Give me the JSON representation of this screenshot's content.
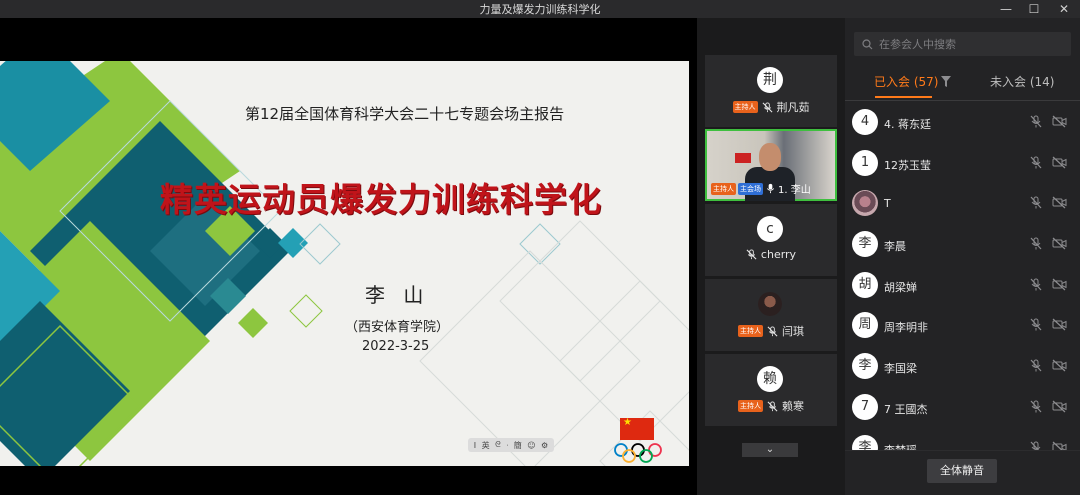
{
  "window": {
    "title": "力量及爆发力训练科学化"
  },
  "slide": {
    "conference": "第12届全国体育科学大会二十七专题会场主报告",
    "headline": "精英运动员爆发力训练科学化",
    "speaker": "李 山",
    "institution": "（西安体育学院）",
    "date": "2022-3-25",
    "toolbar_items": [
      "I",
      "英",
      "ᘓ",
      "ᐧ",
      "簡",
      "☺",
      "⚙"
    ]
  },
  "video_tiles": [
    {
      "avatar": "荆",
      "host_badge": "主持人",
      "name": "荆凡茹"
    },
    {
      "host_badge": "主持人",
      "main_badge": "主会场",
      "name": "1. 李山"
    },
    {
      "avatar": "c",
      "name": "cherry"
    },
    {
      "host_badge": "主持人",
      "name": "闫琪"
    },
    {
      "avatar": "赖",
      "host_badge": "主持人",
      "name": "赖寒"
    }
  ],
  "participants_panel": {
    "search_placeholder": "在参会人中搜索",
    "tab_joined": "已入会 (57)",
    "tab_not_joined": "未入会 (14)",
    "participants": [
      {
        "avatar": "4",
        "name": "4. 蒋东廷"
      },
      {
        "avatar": "1",
        "name": "12苏玉莹"
      },
      {
        "avatar": "",
        "name": "T"
      },
      {
        "avatar": "李",
        "name": "李晨"
      },
      {
        "avatar": "胡",
        "name": "胡梁婵"
      },
      {
        "avatar": "周",
        "name": "周李明非"
      },
      {
        "avatar": "李",
        "name": "李国梁"
      },
      {
        "avatar": "7",
        "name": "7 王國杰"
      },
      {
        "avatar": "李",
        "name": "李梦瑶"
      }
    ],
    "mute_all_label": "全体静音"
  },
  "colors": {
    "accent": "#ff7a1a",
    "headline_red": "#c0141a",
    "host_badge": "#e8621c",
    "main_badge": "#2f6fd6",
    "active_speaker_border": "#3fbf3f"
  }
}
